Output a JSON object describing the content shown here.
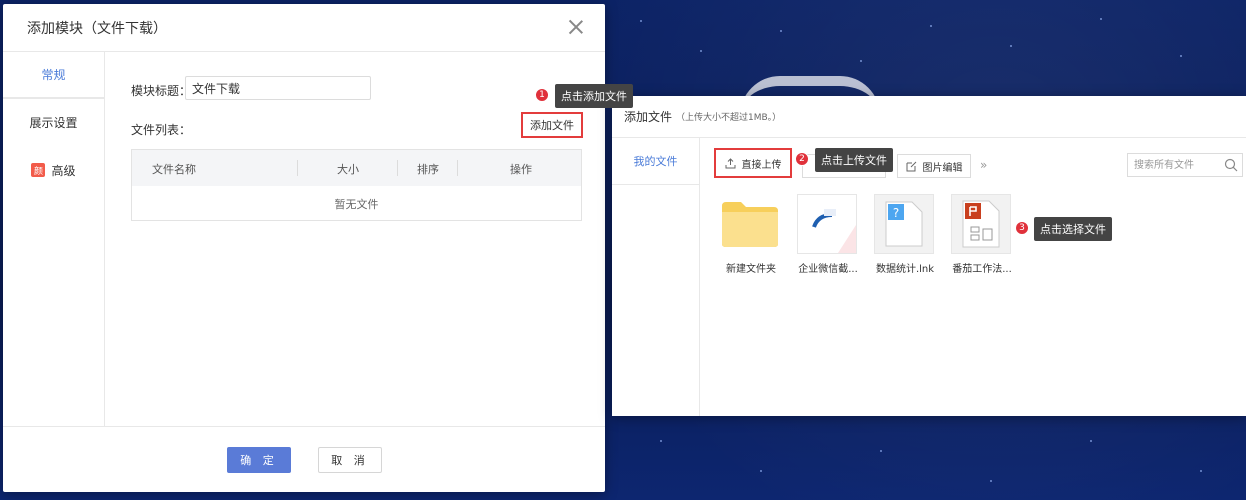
{
  "dialog1": {
    "title": "添加模块（文件下载）",
    "tabs": [
      "常规",
      "展示设置",
      "高级"
    ],
    "advanced_badge": "颜",
    "module_title_label": "模块标题：",
    "module_title_value": "文件下载",
    "file_list_label": "文件列表：",
    "add_file_label": "添加文件",
    "table_headers": [
      "文件名称",
      "大小",
      "排序",
      "操作"
    ],
    "empty_text": "暂无文件",
    "ok_label": "确 定",
    "cancel_label": "取 消"
  },
  "dialog2": {
    "title": "添加文件",
    "subtitle": "（上传大小不超过1MB。）",
    "side_item": "我的文件",
    "upload_label": "直接上传",
    "image_edit_label": "图片编辑",
    "more_label": "»",
    "search_placeholder": "搜索所有文件",
    "files": [
      {
        "name": "新建文件夹",
        "type": "folder"
      },
      {
        "name": "企业微信截...",
        "type": "image"
      },
      {
        "name": "数据统计.lnk",
        "type": "unknown"
      },
      {
        "name": "番茄工作法...",
        "type": "ppt"
      }
    ]
  },
  "callouts": [
    {
      "num": "1",
      "text": "点击添加文件"
    },
    {
      "num": "2",
      "text": "点击上传文件"
    },
    {
      "num": "3",
      "text": "点击选择文件"
    }
  ],
  "colors": {
    "accent": "#4a7bd8",
    "primary_button": "#5a7bd7",
    "highlight_border": "#e33c3c",
    "callout_bg": "#444444",
    "step_badge": "#e0313b",
    "background": "#0b1f5c"
  }
}
